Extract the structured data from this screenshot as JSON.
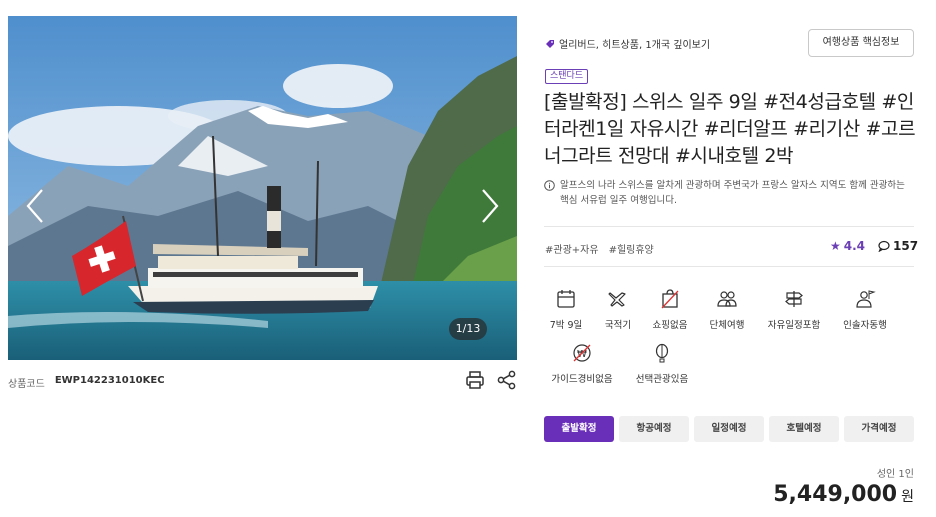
{
  "gallery": {
    "counter": "1/13",
    "icons": {
      "prev": "chevron-left-icon",
      "next": "chevron-right-icon"
    }
  },
  "product": {
    "code_label": "상품코드",
    "code_value": "EWP142231010KEC",
    "tags_text": "얼리버드, 히트상품, 1개국 깊이보기",
    "info_button": "여행상품 핵심정보",
    "badge": "스탠다드",
    "title": "[출발확정] 스위스 일주 9일 #전4성급호텔 #인터라켄1일 자유시간 #리더알프 #리기산 #고르너그라트 전망대 #시내호텔 2박",
    "description": "알프스의 나라 스위스를 알차게 관광하며 주변국가 프랑스 알자스 지역도 함께 관광하는 핵심 서유럽 일주 여행입니다.",
    "hashtags": [
      "#관광+자유",
      "#힐링휴양"
    ],
    "rating": "4.4",
    "comment_count": "157"
  },
  "features": [
    {
      "label": "7박 9일",
      "icon": "calendar-icon"
    },
    {
      "label": "국적기",
      "icon": "airplane-icon"
    },
    {
      "label": "쇼핑없음",
      "icon": "shopping-bag-icon"
    },
    {
      "label": "단체여행",
      "icon": "group-icon"
    },
    {
      "label": "자유일정포함",
      "icon": "signpost-icon"
    },
    {
      "label": "인솔자동행",
      "icon": "guide-person-icon"
    },
    {
      "label": "가이드경비없음",
      "icon": "won-coin-icon"
    },
    {
      "label": "선택관광있음",
      "icon": "balloon-icon"
    }
  ],
  "tabs": [
    "출발확정",
    "항공예정",
    "일정예정",
    "호텔예정",
    "가격예정"
  ],
  "price": {
    "label": "성인 1인",
    "amount": "5,449,000",
    "unit": "원"
  },
  "colors": {
    "accent": "#6a2fb8"
  }
}
